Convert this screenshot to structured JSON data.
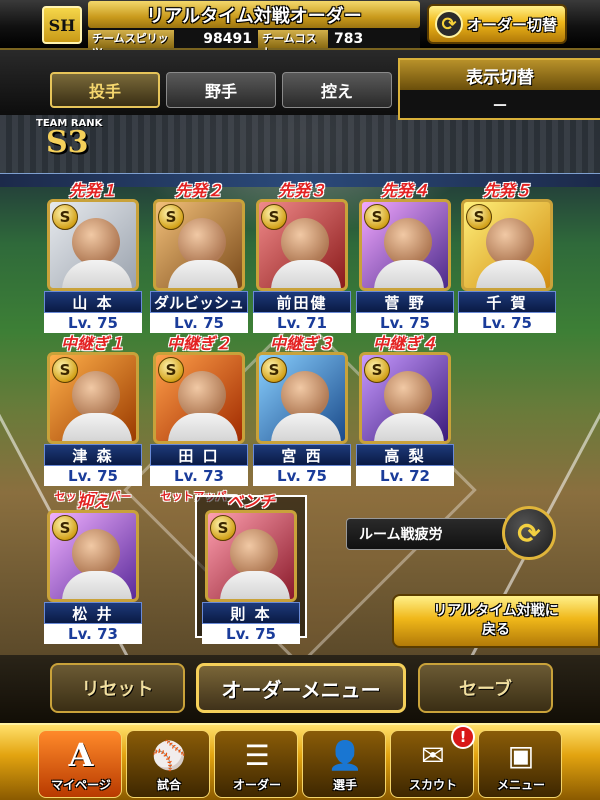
{
  "header": {
    "team_logo": "SH",
    "title": "リアルタイム対戦オーダー",
    "team_spirits_label": "チームスピリッツ",
    "team_spirits_value": "98491",
    "team_cost_label": "チームコスト",
    "team_cost_value": "783",
    "order_switch_label": "オーダー切替"
  },
  "tabs": [
    {
      "label": "投手",
      "active": true
    },
    {
      "label": "野手",
      "active": false
    },
    {
      "label": "控え",
      "active": false
    }
  ],
  "view_toggle": {
    "label": "表示切替",
    "value": "－"
  },
  "team_rank": {
    "label": "TEAM RANK",
    "value": "S3"
  },
  "starters": [
    {
      "role": "先発１",
      "name": "山 本",
      "level": "Lv. 75",
      "card_color": "#cfd3d8"
    },
    {
      "role": "先発２",
      "name": "ダルビッシュ",
      "level": "Lv. 75",
      "card_color": "#c98b3a"
    },
    {
      "role": "先発３",
      "name": "前田健",
      "level": "Lv. 71",
      "card_color": "#d43a3a"
    },
    {
      "role": "先発４",
      "name": "菅 野",
      "level": "Lv. 75",
      "card_color": "#b46ad6"
    },
    {
      "role": "先発５",
      "name": "千 賀",
      "level": "Lv. 75",
      "card_color": "#e8c23a"
    }
  ],
  "relievers": [
    {
      "role": "中継ぎ１",
      "name": "津 森",
      "level": "Lv. 75",
      "tag": "セットアッパー",
      "card_color": "#e07a1a"
    },
    {
      "role": "中継ぎ２",
      "name": "田 口",
      "level": "Lv. 73",
      "tag": "セットアッパー",
      "card_color": "#e0651a"
    },
    {
      "role": "中継ぎ３",
      "name": "宮 西",
      "level": "Lv. 75",
      "tag": "",
      "card_color": "#3a9ad6"
    },
    {
      "role": "中継ぎ４",
      "name": "高 梨",
      "level": "Lv. 72",
      "tag": "",
      "card_color": "#8a4ad0"
    }
  ],
  "closer": {
    "role": "抑え",
    "name": "松 井",
    "level": "Lv. 73",
    "card_color": "#c86ad6"
  },
  "bench": {
    "role": "ベンチ",
    "name": "則 本",
    "level": "Lv. 75",
    "card_color": "#e05a6a"
  },
  "room_fatigue": {
    "label": "ルーム戦疲労"
  },
  "back_button": {
    "line1": "リアルタイム対戦に",
    "line2": "戻る"
  },
  "actions": {
    "reset": "リセット",
    "order_menu": "オーダーメニュー",
    "save": "セーブ"
  },
  "nav": [
    {
      "label": "マイページ",
      "icon": "A"
    },
    {
      "label": "試合",
      "icon": "⚾"
    },
    {
      "label": "オーダー",
      "icon": "☰"
    },
    {
      "label": "選手",
      "icon": "👤"
    },
    {
      "label": "スカウト",
      "icon": "✉",
      "badge": "!"
    },
    {
      "label": "メニュー",
      "icon": "▣"
    }
  ]
}
